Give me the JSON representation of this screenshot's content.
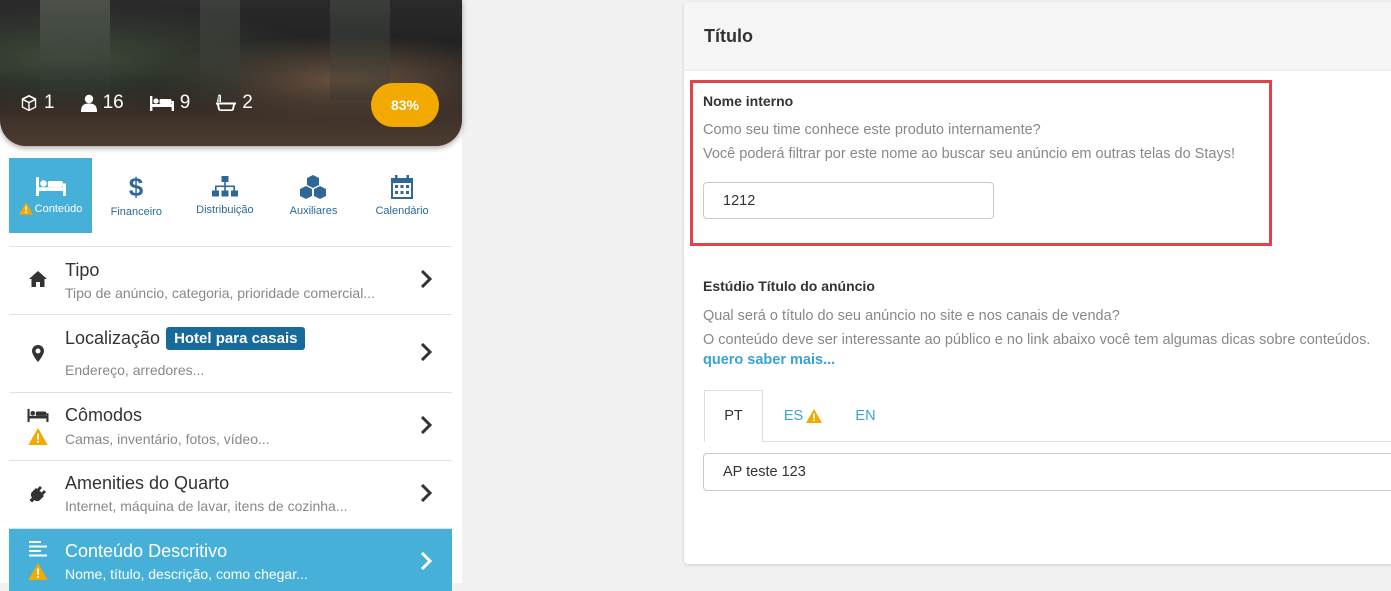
{
  "hero": {
    "stats": [
      {
        "icon": "cube-icon",
        "value": "1"
      },
      {
        "icon": "user-icon",
        "value": "16"
      },
      {
        "icon": "bed-icon",
        "value": "9"
      },
      {
        "icon": "bathtub-icon",
        "value": "2"
      }
    ],
    "completion": "83%"
  },
  "nav": {
    "tabs": [
      {
        "label": "Conteúdo",
        "icon": "bed-icon",
        "warning": true,
        "active": true
      },
      {
        "label": "Financeiro",
        "icon": "dollar-icon"
      },
      {
        "label": "Distribuição",
        "icon": "sitemap-icon"
      },
      {
        "label": "Auxiliares",
        "icon": "cubes-icon"
      },
      {
        "label": "Calendário",
        "icon": "calendar-icon"
      }
    ]
  },
  "menu": {
    "items": [
      {
        "title": "Tipo",
        "subtitle": "Tipo de anúncio, categoria, prioridade comercial...",
        "icon": "home-icon"
      },
      {
        "title": "Localização",
        "badge": "Hotel para casais",
        "subtitle": "Endereço, arredores...",
        "icon": "map-pin-icon"
      },
      {
        "title": "Cômodos",
        "subtitle": "Camas, inventário, fotos, vídeo...",
        "icon": "bed-icon",
        "warning": true
      },
      {
        "title": "Amenities do Quarto",
        "subtitle": "Internet, máquina de lavar, itens de cozinha...",
        "icon": "plug-icon"
      },
      {
        "title": "Conteúdo Descritivo",
        "subtitle": "Nome, título, descrição, como chegar...",
        "icon": "align-left-icon",
        "warning": true,
        "active": true
      }
    ]
  },
  "panel": {
    "title": "Título",
    "internal_name": {
      "label": "Nome interno",
      "help_line1": "Como seu time conhece este produto internamente?",
      "help_line2": "Você poderá filtrar por este nome ao buscar seu anúncio em outras telas do Stays!",
      "value": "1212"
    },
    "listing_title": {
      "label": "Estúdio Título do anúncio",
      "help_line1": "Qual será o título do seu anúncio no site e nos canais de venda?",
      "help_line2": "O conteúdo deve ser interessante ao público e no link abaixo você tem algumas dicas sobre conteúdos.",
      "link": "quero saber mais...",
      "tabs": [
        "PT",
        "ES",
        "EN"
      ],
      "active_tab": "PT",
      "value": "AP teste 123"
    }
  },
  "colors": {
    "accent": "#47b0d8",
    "badge": "#186a9a",
    "progress": "#f2a900",
    "highlight": "#e0434a",
    "warning": "#f2a900"
  }
}
